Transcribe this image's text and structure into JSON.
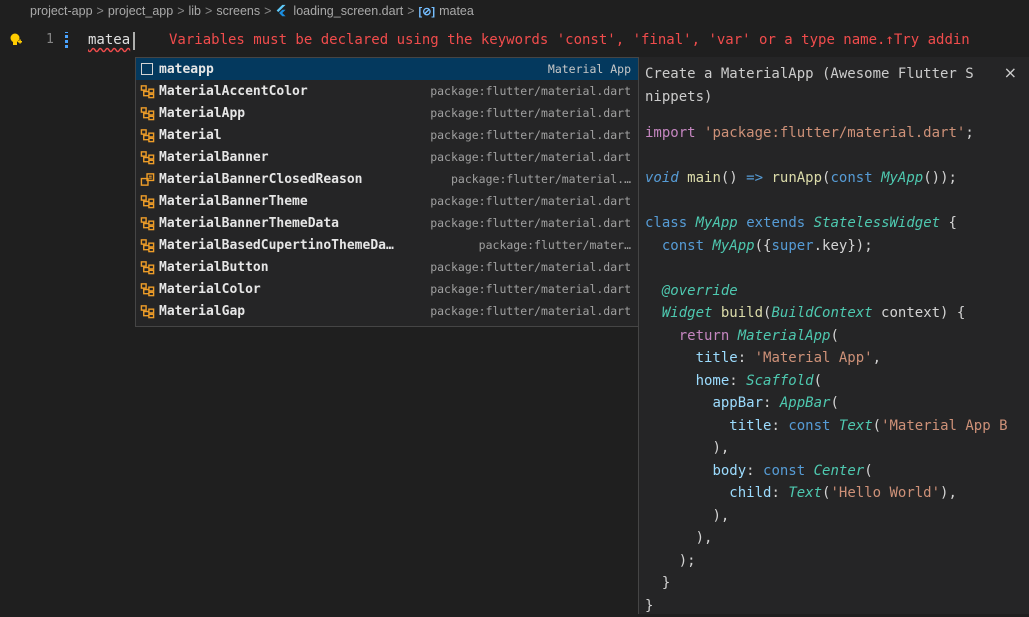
{
  "breadcrumb": {
    "items": [
      "project-app",
      "project_app",
      "lib",
      "screens",
      "loading_screen.dart",
      "matea"
    ],
    "separator": ">"
  },
  "editor": {
    "line_number": "1",
    "typed_text": "matea",
    "error_message": "Variables must be declared using the keywords 'const', 'final', 'var' or a type name.↑Try addin"
  },
  "suggestions": [
    {
      "label": "mateapp",
      "detail": "Material App",
      "icon": "snippet-icon"
    },
    {
      "label": "MaterialAccentColor",
      "detail": "package:flutter/material.dart",
      "icon": "class-icon"
    },
    {
      "label": "MaterialApp",
      "detail": "package:flutter/material.dart",
      "icon": "class-icon"
    },
    {
      "label": "Material",
      "detail": "package:flutter/material.dart",
      "icon": "class-icon"
    },
    {
      "label": "MaterialBanner",
      "detail": "package:flutter/material.dart",
      "icon": "class-icon"
    },
    {
      "label": "MaterialBannerClosedReason",
      "detail": "package:flutter/material.…",
      "icon": "enum-icon"
    },
    {
      "label": "MaterialBannerTheme",
      "detail": "package:flutter/material.dart",
      "icon": "class-icon"
    },
    {
      "label": "MaterialBannerThemeData",
      "detail": "package:flutter/material.dart",
      "icon": "class-icon"
    },
    {
      "label": "MaterialBasedCupertinoThemeDa…",
      "detail": "package:flutter/mater…",
      "icon": "class-icon"
    },
    {
      "label": "MaterialButton",
      "detail": "package:flutter/material.dart",
      "icon": "class-icon"
    },
    {
      "label": "MaterialColor",
      "detail": "package:flutter/material.dart",
      "icon": "class-icon"
    },
    {
      "label": "MaterialGap",
      "detail": "package:flutter/material.dart",
      "icon": "class-icon"
    }
  ],
  "doc": {
    "title_line1": "Create a MaterialApp (Awesome Flutter S",
    "title_line2": "nippets)",
    "close_label": "×",
    "code": {
      "import_kw": "import",
      "import_str": "'package:flutter/material.dart'",
      "semicolon": ";",
      "void_kw": "void",
      "main_fn": "main",
      "main_parens": "() ",
      "arrow": "=>",
      "runapp_fn": "runApp",
      "open_paren": "(",
      "const_kw": "const",
      "myapp_ty": "MyApp",
      "myapp_close": "());",
      "class_kw": "class",
      "extends_kw": "extends",
      "stateless_ty": "StatelessWidget",
      "brace_open": " {",
      "ctor_open": "({",
      "super_kw": "super",
      "key_tail": ".key});",
      "override": "@override",
      "widget_ty": "Widget",
      "build_fn": "build",
      "buildctx_ty": "BuildContext",
      "context_tail": " context) {",
      "return_kw": "return",
      "materialapp_ty": "MaterialApp",
      "title_key": "title",
      "colon": ": ",
      "title_str": "'Material App'",
      "comma": ",",
      "home_key": "home",
      "scaffold_ty": "Scaffold",
      "appbar_key": "appBar",
      "appbar_ty": "AppBar",
      "text_ty": "Text",
      "appbar_title_str": "'Material App B",
      "close_comma": "),",
      "body_key": "body",
      "center_ty": "Center",
      "child_key": "child",
      "hello_str": "'Hello World'",
      "close_semicolon": ");",
      "close_brace": "}"
    }
  },
  "colors": {
    "background": "#1f1f1f",
    "error": "#f14c4c",
    "selection": "#04395e",
    "class_icon": "#ee9d28",
    "enum_icon": "#ee9d28"
  }
}
